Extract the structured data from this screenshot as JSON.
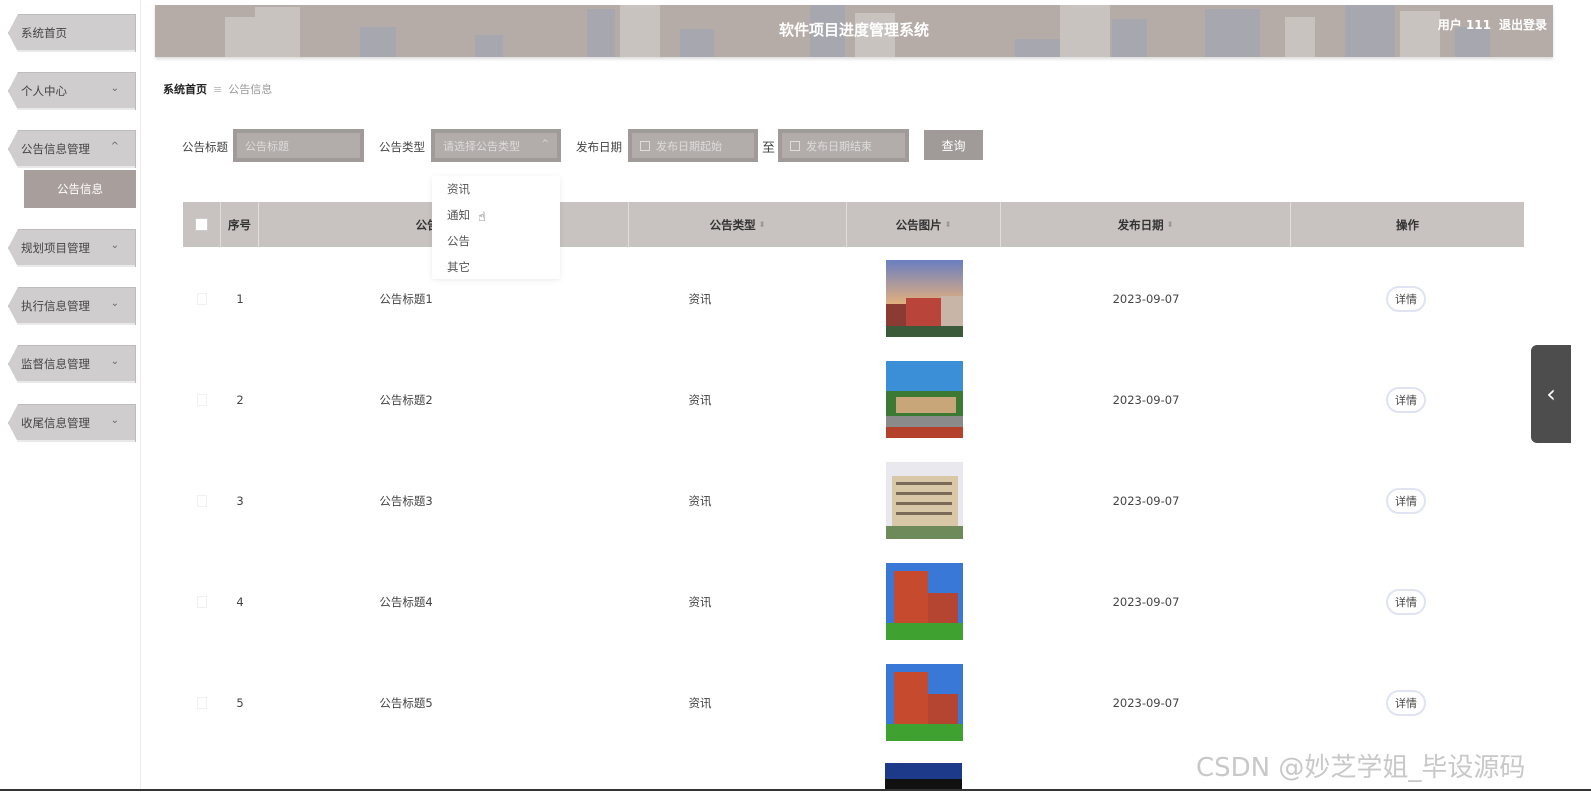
{
  "header": {
    "title": "软件项目进度管理系统",
    "user": "用户 111",
    "logout": "退出登录"
  },
  "sidebar": {
    "items": [
      {
        "label": "系统首页",
        "chevron": ""
      },
      {
        "label": "个人中心",
        "chevron": "⌄"
      },
      {
        "label": "公告信息管理",
        "chevron": "^"
      },
      {
        "label": "规划项目管理",
        "chevron": "⌄"
      },
      {
        "label": "执行信息管理",
        "chevron": "⌄"
      },
      {
        "label": "监督信息管理",
        "chevron": "⌄"
      },
      {
        "label": "收尾信息管理",
        "chevron": "⌄"
      }
    ],
    "active_sub": "公告信息"
  },
  "breadcrumb": {
    "home": "系统首页",
    "separator": "≡",
    "current": "公告信息"
  },
  "search": {
    "title_label": "公告标题",
    "title_placeholder": "公告标题",
    "type_label": "公告类型",
    "type_placeholder": "请选择公告类型",
    "date_label": "发布日期",
    "date_start_placeholder": "发布日期起始",
    "to": "至",
    "date_end_placeholder": "发布日期结束",
    "query": "查询",
    "type_options": [
      "资讯",
      "通知",
      "公告",
      "其它"
    ]
  },
  "table": {
    "headers": [
      "序号",
      "公告标题",
      "公告类型",
      "公告图片",
      "发布日期",
      "操作"
    ],
    "rows": [
      {
        "no": "1",
        "title": "公告标题1",
        "type": "资讯",
        "date": "2023-09-07",
        "action": "详情"
      },
      {
        "no": "2",
        "title": "公告标题2",
        "type": "资讯",
        "date": "2023-09-07",
        "action": "详情"
      },
      {
        "no": "3",
        "title": "公告标题3",
        "type": "资讯",
        "date": "2023-09-07",
        "action": "详情"
      },
      {
        "no": "4",
        "title": "公告标题4",
        "type": "资讯",
        "date": "2023-09-07",
        "action": "详情"
      },
      {
        "no": "5",
        "title": "公告标题5",
        "type": "资讯",
        "date": "2023-09-07",
        "action": "详情"
      }
    ]
  },
  "watermark": "CSDN @妙芝学姐_毕设源码",
  "colors": {
    "header_bg": "#b5aca8",
    "sidebar_item": "#cfcdcd",
    "active_sub": "#a89e9b",
    "table_head": "#c8c3c1"
  }
}
